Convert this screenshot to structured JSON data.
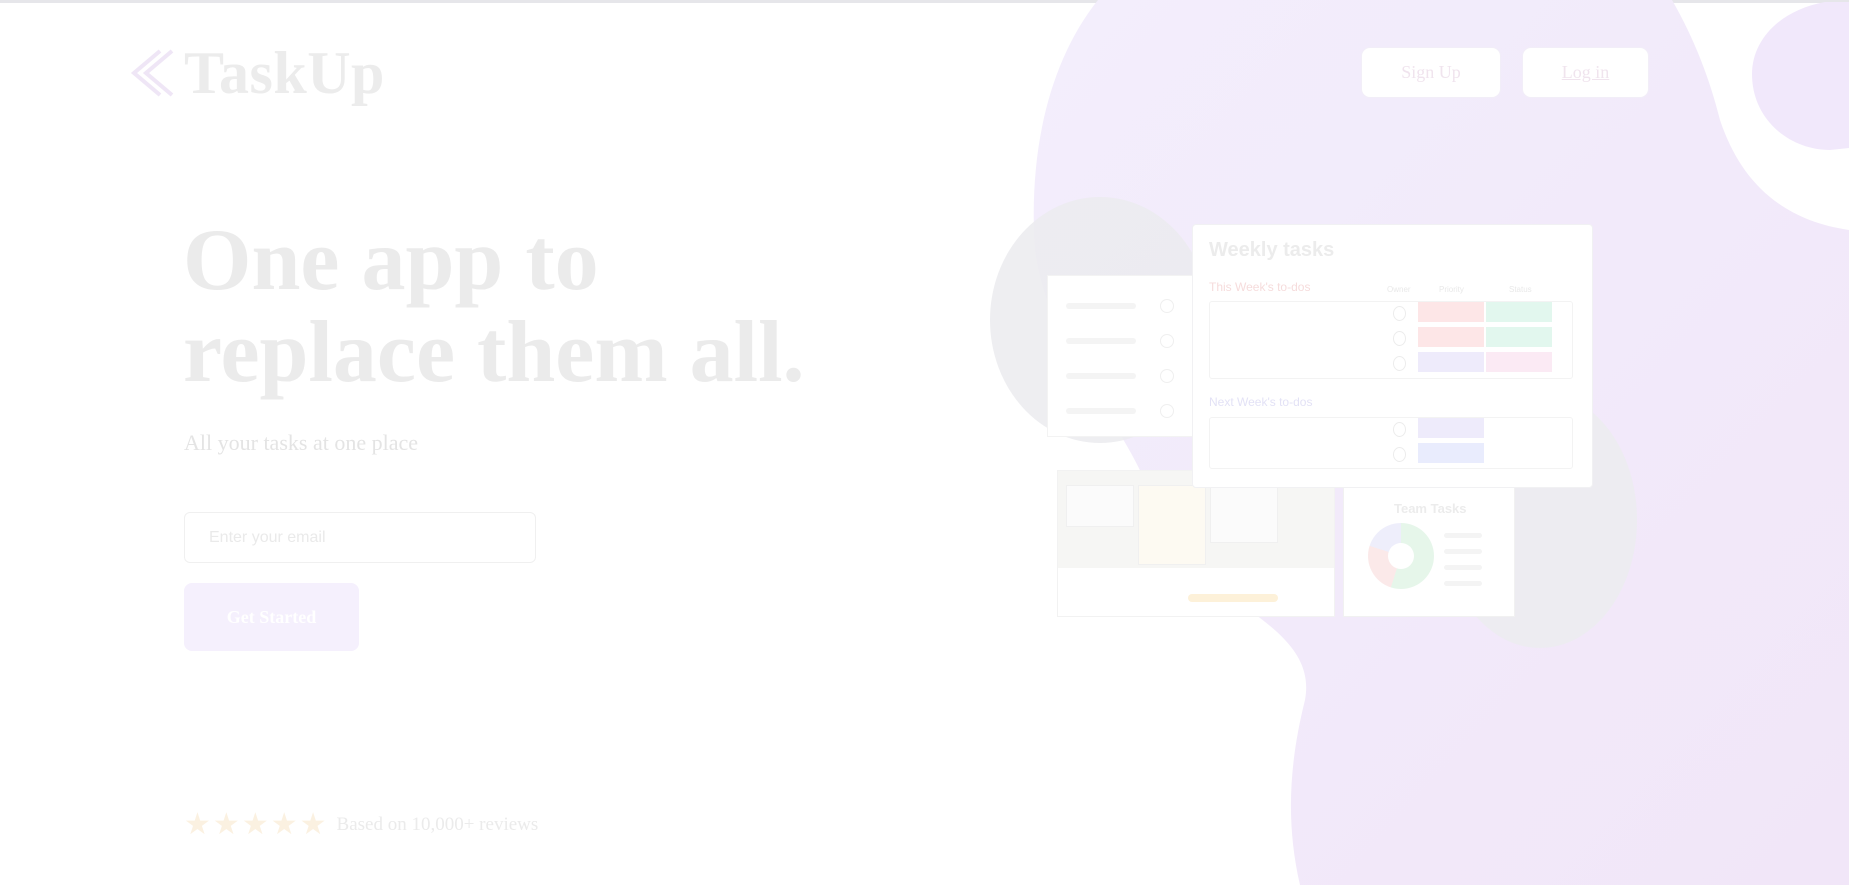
{
  "brand": {
    "name": "TaskUp",
    "logo_icon": "double-chevron-left-icon"
  },
  "nav": {
    "signup_label": "Sign Up",
    "login_label": "Log in"
  },
  "hero": {
    "title_line1": "One app to",
    "title_line2": "replace them all.",
    "subtitle": "All your tasks at one place",
    "email_placeholder": "Enter your email",
    "cta_label": "Get Started"
  },
  "rating": {
    "stars": 5,
    "star_icon": "star-icon",
    "text": "Based on 10,000+ reviews"
  },
  "mockup": {
    "weekly": {
      "title": "Weekly tasks",
      "this_week_label": "This Week's to-dos",
      "next_week_label": "Next Week's to-dos",
      "col_owner": "Owner",
      "col_priority": "Priority",
      "col_status": "Status"
    },
    "team_tasks_title": "Team Tasks"
  },
  "colors": {
    "accent": "#f5f0fd",
    "blob": "#f1e8fb",
    "title_text": "#ebebeb",
    "star": "#fbf1e1"
  }
}
